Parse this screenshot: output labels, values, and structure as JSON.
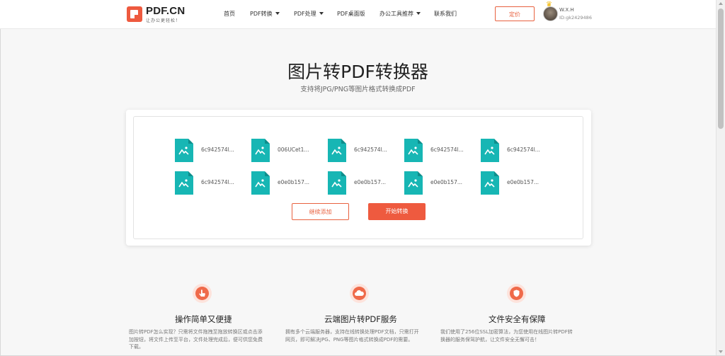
{
  "header": {
    "logo_text": "PDF.CN",
    "logo_sub": "让办公更轻松！",
    "nav": [
      {
        "label": "首页",
        "has_caret": false
      },
      {
        "label": "PDF转换",
        "has_caret": true
      },
      {
        "label": "PDF处理",
        "has_caret": true
      },
      {
        "label": "PDF桌面版",
        "has_caret": false
      },
      {
        "label": "办公工具推荐",
        "has_caret": true
      },
      {
        "label": "联系我们",
        "has_caret": false
      }
    ],
    "price_label": "定价",
    "user_name": "W.X.H",
    "user_id": "ID:gk2429486"
  },
  "hero": {
    "title": "图片转PDF转换器",
    "subtitle": "支持将JPG/PNG等图片格式转换成PDF"
  },
  "files": [
    "6c942574l...",
    "006UCet1...",
    "6c942574l...",
    "6c942574l...",
    "6c942574l...",
    "6c942574l...",
    "e0e0b157...",
    "e0e0b157...",
    "e0e0b157...",
    "e0e0b157..."
  ],
  "actions": {
    "add_label": "继续添加",
    "start_label": "开始转换"
  },
  "features": [
    {
      "icon": "hand-pointer-icon",
      "title": "操作简单又便捷",
      "desc": "图片转PDF怎么实现？只需将文件拖拽至拖放转换区或点击添加按钮，将文件上传至平台，文件处理完成后，便可供您免费下载。"
    },
    {
      "icon": "cloud-icon",
      "title": "云端图片转PDF服务",
      "desc": "拥有多个云端服务器，支持在线转换处理PDF文档，只需打开网页，即可解决JPG、PNG等图片格式转换成PDF的需要。"
    },
    {
      "icon": "shield-icon",
      "title": "文件安全有保障",
      "desc": "我们使用了256位SSL加密算法，为您使用在线图片转PDF转换器的服务保驾护航，让文件安全无懈可击！"
    }
  ],
  "colors": {
    "accent": "#ee5a3f",
    "file_icon": "#17b6b4"
  }
}
